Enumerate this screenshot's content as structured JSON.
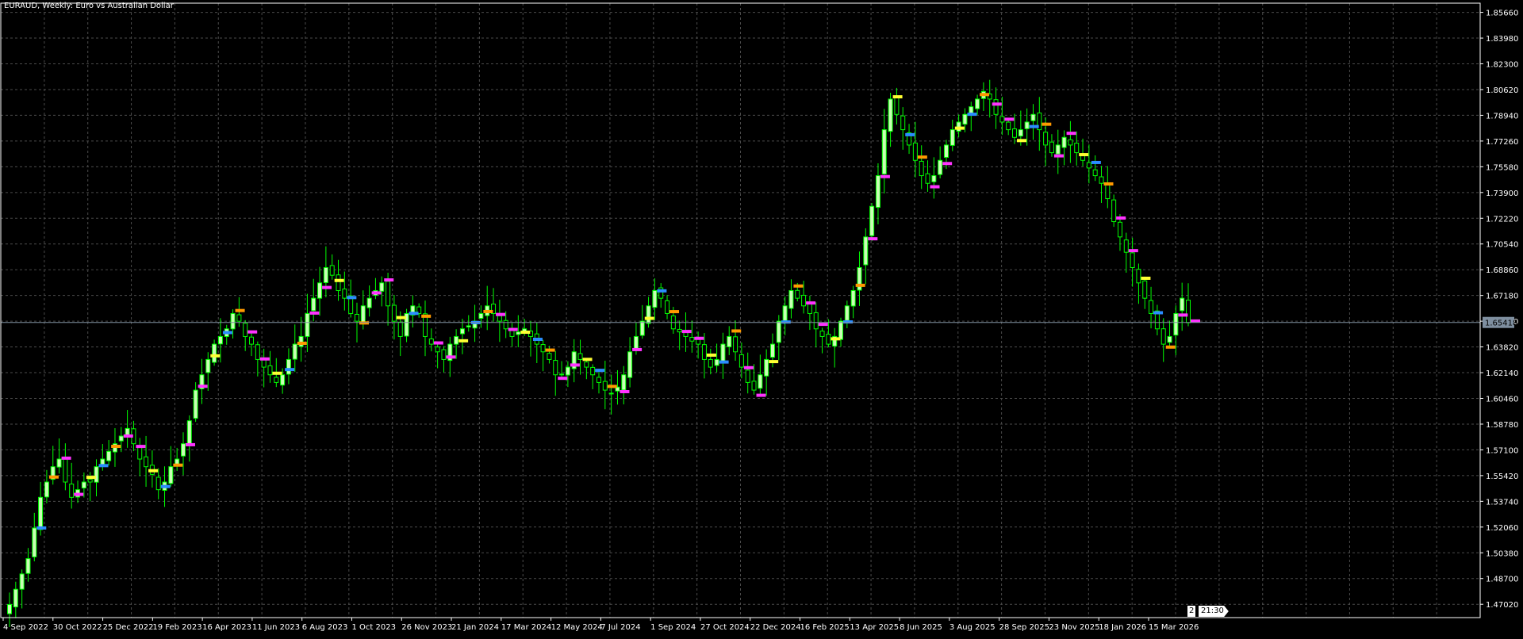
{
  "window": {
    "title": "EURAUD, Weekly:  Euro vs Australian Dollar"
  },
  "colors": {
    "background": "#000000",
    "grid": "#4b4b4b",
    "frame": "#ffffff",
    "bull_candle": "#c8ffb4",
    "bear_candle": "#000000",
    "wick": "#00ff00",
    "bid_line": "#7f8fa0",
    "price_tag_bg": "#7f8fa0",
    "marker_magenta": "#ff33ff",
    "marker_orange": "#ff9900",
    "marker_yellow": "#ffff33",
    "marker_blue": "#2b8cff",
    "marker_red": "#ff3030",
    "axis_text": "#ffffff"
  },
  "countdown": {
    "bars_label": "2",
    "time_label": "21:30"
  },
  "chart_data": {
    "type": "candlestick",
    "symbol": "EURAUD",
    "timeframe": "Weekly",
    "title": "EURAUD, Weekly:  Euro vs Australian Dollar",
    "current_price": "1.65418",
    "current_price_value": 1.65418,
    "ylim": [
      1.4615,
      1.8626
    ],
    "y_ticks": [
      "1.85660",
      "1.83980",
      "1.82300",
      "1.80620",
      "1.78940",
      "1.77260",
      "1.75580",
      "1.73900",
      "1.72220",
      "1.70540",
      "1.68860",
      "1.67180",
      "1.65500",
      "1.63820",
      "1.62140",
      "1.60460",
      "1.58780",
      "1.57100",
      "1.55420",
      "1.53740",
      "1.52060",
      "1.50380",
      "1.48700",
      "1.47020"
    ],
    "x_labels": [
      "4 Sep 2022",
      "30 Oct 2022",
      "25 Dec 2022",
      "19 Feb 2023",
      "16 Apr 2023",
      "11 Jun 2023",
      "6 Aug 2023",
      "1 Oct 2023",
      "26 Nov 2023",
      "21 Jan 2024",
      "17 Mar 2024",
      "12 May 2024",
      "7 Jul 2024",
      "1 Sep 2024",
      "27 Oct 2024",
      "22 Dec 2024",
      "16 Feb 2025",
      "13 Apr 2025",
      "8 Jun 2025",
      "3 Aug 2025",
      "28 Sep 2025",
      "23 Nov 2025",
      "18 Jan 2026",
      "15 Mar 2026"
    ],
    "grid": true,
    "bar_count": 189,
    "weekly_closes": [
      1.47,
      1.48,
      1.49,
      1.5,
      1.52,
      1.54,
      1.55,
      1.56,
      1.565,
      1.55,
      1.54,
      1.545,
      1.55,
      1.55,
      1.56,
      1.565,
      1.57,
      1.575,
      1.58,
      1.585,
      1.575,
      1.565,
      1.56,
      1.555,
      1.545,
      1.55,
      1.56,
      1.565,
      1.575,
      1.59,
      1.61,
      1.62,
      1.63,
      1.64,
      1.645,
      1.65,
      1.66,
      1.655,
      1.645,
      1.64,
      1.63,
      1.625,
      1.62,
      1.615,
      1.62,
      1.63,
      1.64,
      1.645,
      1.66,
      1.67,
      1.68,
      1.69,
      1.685,
      1.675,
      1.67,
      1.66,
      1.655,
      1.665,
      1.67,
      1.675,
      1.68,
      1.665,
      1.655,
      1.645,
      1.66,
      1.665,
      1.66,
      1.645,
      1.64,
      1.635,
      1.63,
      1.64,
      1.645,
      1.65,
      1.652,
      1.655,
      1.66,
      1.665,
      1.66,
      1.655,
      1.65,
      1.645,
      1.648,
      1.65,
      1.645,
      1.64,
      1.635,
      1.63,
      1.62,
      1.62,
      1.625,
      1.635,
      1.63,
      1.625,
      1.62,
      1.615,
      1.61,
      1.608,
      1.612,
      1.62,
      1.635,
      1.645,
      1.655,
      1.665,
      1.675,
      1.67,
      1.66,
      1.65,
      1.648,
      1.645,
      1.642,
      1.64,
      1.63,
      1.625,
      1.63,
      1.64,
      1.645,
      1.635,
      1.625,
      1.615,
      1.61,
      1.62,
      1.63,
      1.64,
      1.655,
      1.665,
      1.675,
      1.67,
      1.665,
      1.66,
      1.65,
      1.645,
      1.64,
      1.645,
      1.655,
      1.665,
      1.675,
      1.69,
      1.71,
      1.73,
      1.75,
      1.78,
      1.8,
      1.79,
      1.78,
      1.77,
      1.76,
      1.75,
      1.745,
      1.75,
      1.76,
      1.77,
      1.78,
      1.785,
      1.79,
      1.795,
      1.8,
      1.805,
      1.8,
      1.79,
      1.785,
      1.78,
      1.775,
      1.78,
      1.785,
      1.79,
      1.78,
      1.77,
      1.765,
      1.77,
      1.775,
      1.77,
      1.765,
      1.76,
      1.755,
      1.75,
      1.745,
      1.735,
      1.72,
      1.71,
      1.7,
      1.69,
      1.68,
      1.67,
      1.66,
      1.65,
      1.64,
      1.645,
      1.66,
      1.67,
      1.654
    ]
  }
}
